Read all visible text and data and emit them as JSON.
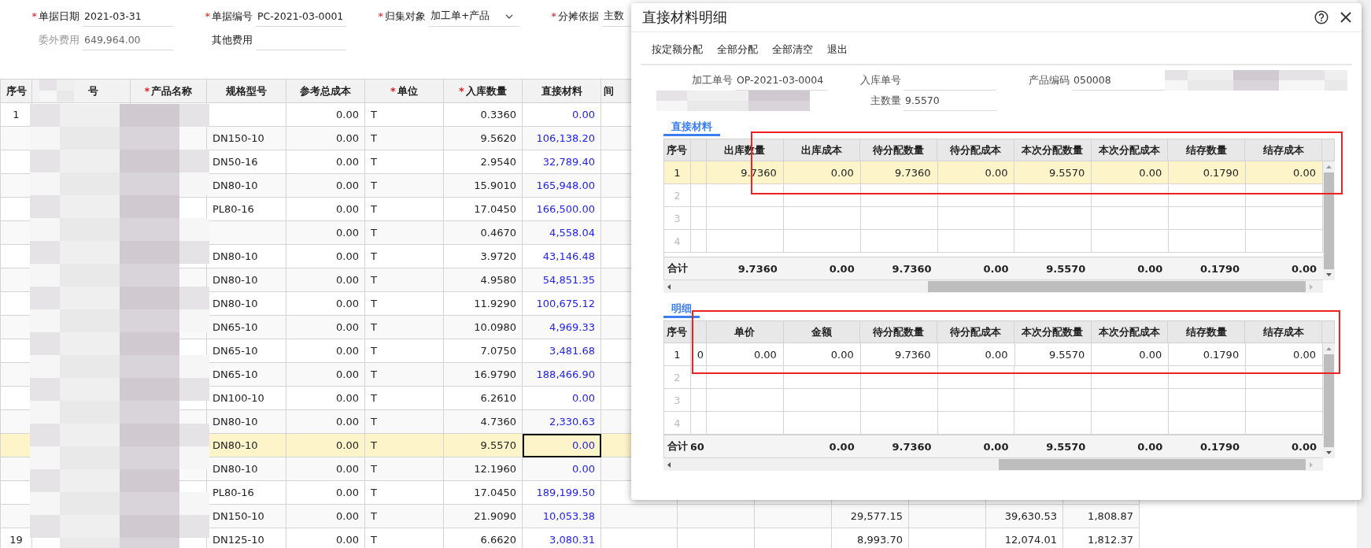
{
  "main_form": {
    "fields": [
      {
        "required_mark": "*",
        "label": "单据日期",
        "value": "2021-03-31",
        "kind": "text",
        "disabled": false
      },
      {
        "required_mark": "*",
        "label": "单据编号",
        "value": "PC-2021-03-0001",
        "kind": "text",
        "disabled": false
      },
      {
        "required_mark": "*",
        "label": "归集对象",
        "value": "加工单+产品",
        "kind": "select",
        "disabled": false
      },
      {
        "required_mark": "*",
        "label": "分摊依据",
        "value": "主数",
        "kind": "text",
        "disabled": false
      },
      {
        "label": "委外费用",
        "value": "649,964.00",
        "kind": "text",
        "disabled": true
      },
      {
        "label": "其他费用",
        "kind": "text",
        "disabled": false
      }
    ]
  },
  "main_table": {
    "columns": [
      {
        "label": "序号"
      },
      {
        "label": "号"
      },
      {
        "required_mark": "*",
        "label": "产品名称"
      },
      {
        "label": "规格型号"
      },
      {
        "label": "参考总成本"
      },
      {
        "required_mark": "*",
        "label": "单位"
      },
      {
        "required_mark": "*",
        "label": "入库数量"
      },
      {
        "label": "直接材料"
      },
      {
        "label": "间"
      }
    ],
    "rows": [
      {
        "seq": "1",
        "ref_cost": "0.00",
        "unit": "T",
        "in_qty": "0.3360",
        "direct_material": "0.00",
        "selected": false,
        "focused": false
      },
      {
        "spec": "DN150-10",
        "ref_cost": "0.00",
        "unit": "T",
        "in_qty": "9.5620",
        "direct_material": "106,138.20",
        "selected": false,
        "focused": false
      },
      {
        "spec": "DN50-16",
        "ref_cost": "0.00",
        "unit": "T",
        "in_qty": "2.9540",
        "direct_material": "32,789.40",
        "selected": false,
        "focused": false
      },
      {
        "spec": "DN80-10",
        "ref_cost": "0.00",
        "unit": "T",
        "in_qty": "15.9010",
        "direct_material": "165,948.00",
        "selected": false,
        "focused": false
      },
      {
        "spec": "PL80-16",
        "ref_cost": "0.00",
        "unit": "T",
        "in_qty": "17.0450",
        "direct_material": "166,500.00",
        "selected": false,
        "focused": false
      },
      {
        "ref_cost": "0.00",
        "unit": "T",
        "in_qty": "0.4670",
        "direct_material": "4,558.04",
        "selected": false,
        "focused": false
      },
      {
        "spec": "DN80-10",
        "ref_cost": "0.00",
        "unit": "T",
        "in_qty": "3.9720",
        "direct_material": "43,146.48",
        "selected": false,
        "focused": false
      },
      {
        "spec": "DN80-10",
        "ref_cost": "0.00",
        "unit": "T",
        "in_qty": "4.9580",
        "direct_material": "54,851.35",
        "selected": false,
        "focused": false
      },
      {
        "spec": "DN80-10",
        "ref_cost": "0.00",
        "unit": "T",
        "in_qty": "11.9290",
        "direct_material": "100,675.12",
        "selected": false,
        "focused": false
      },
      {
        "spec": "DN65-10",
        "ref_cost": "0.00",
        "unit": "T",
        "in_qty": "10.0980",
        "direct_material": "4,969.33",
        "selected": false,
        "focused": false
      },
      {
        "spec": "DN65-10",
        "ref_cost": "0.00",
        "unit": "T",
        "in_qty": "7.0750",
        "direct_material": "3,481.68",
        "selected": false,
        "focused": false
      },
      {
        "spec": "DN65-10",
        "ref_cost": "0.00",
        "unit": "T",
        "in_qty": "16.9790",
        "direct_material": "188,466.90",
        "selected": false,
        "focused": false
      },
      {
        "spec": "DN100-10",
        "ref_cost": "0.00",
        "unit": "T",
        "in_qty": "6.2610",
        "direct_material": "0.00",
        "selected": false,
        "focused": false
      },
      {
        "spec": "DN80-10",
        "ref_cost": "0.00",
        "unit": "T",
        "in_qty": "4.7360",
        "direct_material": "2,330.63",
        "selected": false,
        "focused": false
      },
      {
        "spec": "DN80-10",
        "ref_cost": "0.00",
        "unit": "T",
        "in_qty": "9.5570",
        "direct_material": "0.00",
        "selected": true,
        "focused": true
      },
      {
        "spec": "DN80-10",
        "ref_cost": "0.00",
        "unit": "T",
        "in_qty": "12.1960",
        "direct_material": "0.00",
        "selected": false,
        "focused": false
      },
      {
        "spec": "PL80-16",
        "ref_cost": "0.00",
        "unit": "T",
        "in_qty": "17.0450",
        "direct_material": "189,199.50",
        "selected": false,
        "focused": false
      },
      {
        "spec": "DN150-10",
        "ref_cost": "0.00",
        "unit": "T",
        "in_qty": "21.9090",
        "direct_material": "10,053.38",
        "column_12": "29,577.15",
        "column_14": "39,630.53",
        "column_15": "1,808.87",
        "selected": false,
        "focused": false
      },
      {
        "seq": "19",
        "spec": "DN125-10",
        "ref_cost": "0.00",
        "unit": "T",
        "in_qty": "6.6620",
        "direct_material": "3,080.31",
        "column_12": "8,993.70",
        "column_14": "12,074.01",
        "column_15": "1,812.37",
        "selected": false,
        "focused": false
      }
    ]
  },
  "dialog": {
    "title": "直接材料明细",
    "toolbar": [
      "按定额分配",
      "全部分配",
      "全部清空",
      "退出"
    ],
    "fields": [
      {
        "label": "加工单号",
        "value": "OP-2021-03-0004"
      },
      {
        "label": "入库单号"
      },
      {
        "label": "产品编码",
        "value": "050008"
      },
      {
        "label": "主数量",
        "value": "9.5570"
      }
    ],
    "grids": [
      {
        "tab": {
          "label": "直接材料",
          "selected": true
        },
        "seq_header": "序号",
        "columns": [
          "出库数量",
          "出库成本",
          "待分配数量",
          "待分配成本",
          "本次分配数量",
          "本次分配成本",
          "结存数量",
          "结存成本"
        ],
        "rows": [
          {
            "seq": "1",
            "selected": true,
            "cells": [
              "9.7360",
              "0.00",
              "9.7360",
              "0.00",
              "9.5570",
              "0.00",
              "0.1790",
              "0.00"
            ]
          },
          {
            "seq": "2",
            "selected": false
          },
          {
            "seq": "3",
            "selected": false
          },
          {
            "seq": "4",
            "selected": false
          }
        ],
        "totals": {
          "label": "合计",
          "cells": [
            "9.7360",
            "0.00",
            "9.7360",
            "0.00",
            "9.5570",
            "0.00",
            "0.1790",
            "0.00"
          ]
        }
      },
      {
        "tab": {
          "label": "明细",
          "selected": true
        },
        "seq_header": "序号",
        "columns": [
          "单价",
          "金额",
          "待分配数量",
          "待分配成本",
          "本次分配数量",
          "本次分配成本",
          "结存数量",
          "结存成本"
        ],
        "rows": [
          {
            "seq": "1",
            "selected": false,
            "column_2": "0",
            "cells": [
              "0.00",
              "0.00",
              "9.7360",
              "0.00",
              "9.5570",
              "0.00",
              "0.1790",
              "0.00"
            ]
          },
          {
            "seq": "2",
            "selected": false
          },
          {
            "seq": "3",
            "selected": false
          },
          {
            "seq": "4",
            "selected": false
          }
        ],
        "totals": {
          "label": "合计",
          "column_2": "60",
          "cells": [
            null,
            "0.00",
            "9.7360",
            "0.00",
            "9.5570",
            "0.00",
            "0.1790",
            "0.00"
          ]
        }
      }
    ]
  }
}
